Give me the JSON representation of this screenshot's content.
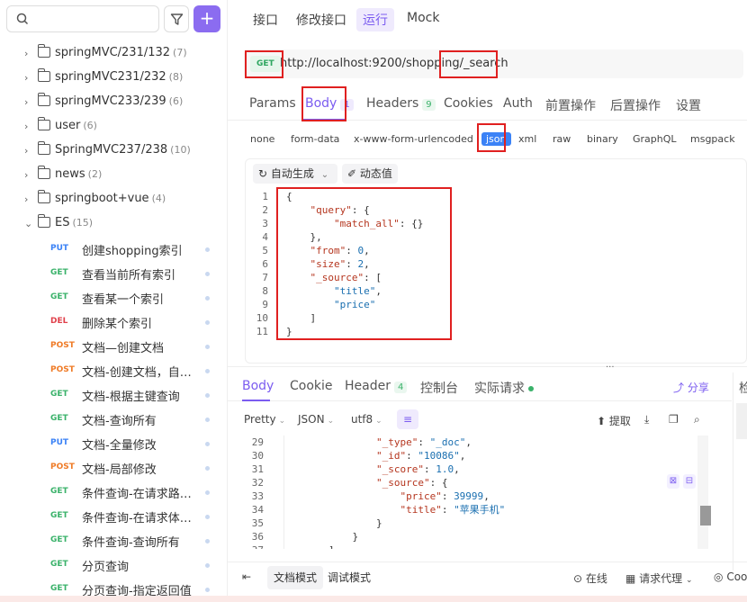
{
  "sidebar": {
    "search": {
      "placeholder": ""
    },
    "add_label": "+",
    "folders": [
      {
        "name": "springMVC/231/132",
        "count": "(7)",
        "chevron": "›"
      },
      {
        "name": "springMVC231/232",
        "count": "(8)",
        "chevron": "›"
      },
      {
        "name": "springMVC233/239",
        "count": "(6)",
        "chevron": "›"
      },
      {
        "name": "user",
        "count": "(6)",
        "chevron": "›"
      },
      {
        "name": "SpringMVC237/238",
        "count": "(10)",
        "chevron": "›"
      },
      {
        "name": "news",
        "count": "(2)",
        "chevron": "›"
      },
      {
        "name": "springboot+vue",
        "count": "(4)",
        "chevron": "›"
      },
      {
        "name": "ES",
        "count": "(15)",
        "chevron": "⌄"
      }
    ],
    "requests": [
      {
        "method": "PUT",
        "name": "创建shopping索引",
        "color": "#3b82f6"
      },
      {
        "method": "GET",
        "name": "查看当前所有索引",
        "color": "#3ab26a"
      },
      {
        "method": "GET",
        "name": "查看某一个索引",
        "color": "#3ab26a"
      },
      {
        "method": "DEL",
        "name": "删除某个索引",
        "color": "#e0414b"
      },
      {
        "method": "POST",
        "name": "文档—创建文档",
        "color": "#ef7b27"
      },
      {
        "method": "POST",
        "name": "文档-创建文档，自定...",
        "color": "#ef7b27"
      },
      {
        "method": "GET",
        "name": "文档-根据主键查询",
        "color": "#3ab26a"
      },
      {
        "method": "GET",
        "name": "文档-查询所有",
        "color": "#3ab26a"
      },
      {
        "method": "PUT",
        "name": "文档-全量修改",
        "color": "#3b82f6"
      },
      {
        "method": "POST",
        "name": "文档-局部修改",
        "color": "#ef7b27"
      },
      {
        "method": "GET",
        "name": "条件查询-在请求路径...",
        "color": "#3ab26a"
      },
      {
        "method": "GET",
        "name": "条件查询-在请求体中...",
        "color": "#3ab26a"
      },
      {
        "method": "GET",
        "name": "条件查询-查询所有",
        "color": "#3ab26a"
      },
      {
        "method": "GET",
        "name": "分页查询",
        "color": "#3ab26a"
      },
      {
        "method": "GET",
        "name": "分页查询-指定返回值",
        "color": "#3ab26a"
      }
    ]
  },
  "top_tabs": [
    "接口",
    "修改接口",
    "运行",
    "Mock"
  ],
  "url_bar": {
    "method": "GET",
    "url": "http://localhost:9200/shopping/_search"
  },
  "req_tabs": {
    "params": "Params",
    "body": "Body",
    "body_count": "1",
    "headers": "Headers",
    "headers_count": "9",
    "cookies": "Cookies",
    "auth": "Auth",
    "pre": "前置操作",
    "post": "后置操作",
    "settings": "设置"
  },
  "body_types": [
    "none",
    "form-data",
    "x-www-form-urlencoded",
    "json",
    "xml",
    "raw",
    "binary",
    "GraphQL",
    "msgpack"
  ],
  "editor_tools": {
    "auto": "自动生成",
    "dynamic": "动态值"
  },
  "request_code": [
    {
      "ln": "1",
      "text": "{"
    },
    {
      "ln": "2",
      "text": "    \"query\": {"
    },
    {
      "ln": "3",
      "text": "        \"match_all\": {}"
    },
    {
      "ln": "4",
      "text": "    },"
    },
    {
      "ln": "5",
      "text": "    \"from\": 0,"
    },
    {
      "ln": "6",
      "text": "    \"size\": 2,"
    },
    {
      "ln": "7",
      "text": "    \"_source\": ["
    },
    {
      "ln": "8",
      "text": "        \"title\","
    },
    {
      "ln": "9",
      "text": "        \"price\""
    },
    {
      "ln": "10",
      "text": "    ]"
    },
    {
      "ln": "11",
      "text": "}"
    }
  ],
  "splitter": "...",
  "res_tabs": {
    "body": "Body",
    "cookie": "Cookie",
    "header": "Header",
    "header_count": "4",
    "console": "控制台",
    "actual": "实际请求",
    "share": "分享",
    "right_cut": "检"
  },
  "fmt": {
    "pretty": "Pretty",
    "json": "JSON",
    "utf8": "utf8",
    "extract": "提取"
  },
  "response_code": [
    {
      "ln": "29",
      "text": "                \"_type\": \"_doc\","
    },
    {
      "ln": "30",
      "text": "                \"_id\": \"10086\","
    },
    {
      "ln": "31",
      "text": "                \"_score\": 1.0,"
    },
    {
      "ln": "32",
      "text": "                \"_source\": {"
    },
    {
      "ln": "33",
      "text": "                    \"price\": 39999,"
    },
    {
      "ln": "34",
      "text": "                    \"title\": \"苹果手机\""
    },
    {
      "ln": "35",
      "text": "                }"
    },
    {
      "ln": "36",
      "text": "            }"
    },
    {
      "ln": "37",
      "text": "        ]"
    }
  ],
  "bottom": {
    "doc_mode": "文档模式",
    "debug_mode": "调试模式",
    "online": "在线",
    "proxy": "请求代理",
    "cookie": "Coo"
  }
}
